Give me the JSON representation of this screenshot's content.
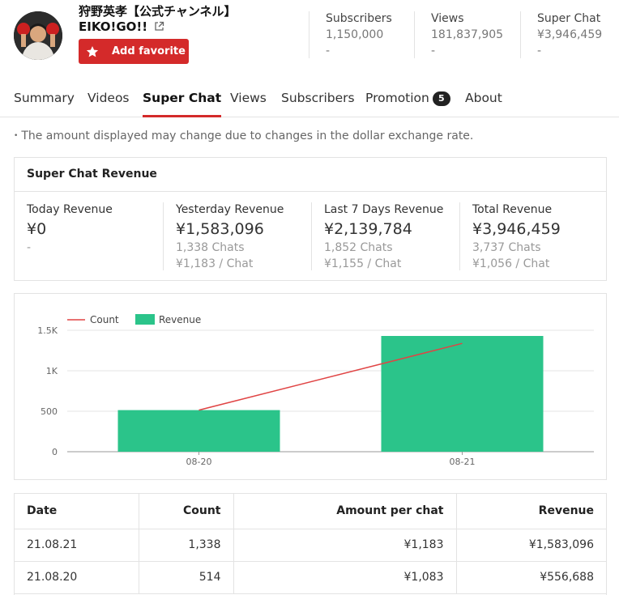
{
  "channel": {
    "name_line1": "狩野英孝【公式チャンネル】",
    "name_line2": "EIKO!GO!!",
    "favorite_label": "Add favorite"
  },
  "stats": [
    {
      "label": "Subscribers",
      "value": "1,150,000",
      "delta": "-"
    },
    {
      "label": "Views",
      "value": "181,837,905",
      "delta": "-"
    },
    {
      "label": "Super Chat",
      "value": "¥3,946,459",
      "delta": "-"
    }
  ],
  "tabs": [
    {
      "label": "Summary"
    },
    {
      "label": "Videos"
    },
    {
      "label": "Super Chat",
      "active": true
    },
    {
      "label": "Views"
    },
    {
      "label": "Subscribers"
    },
    {
      "label": "Promotion",
      "badge": "5"
    },
    {
      "label": "About"
    }
  ],
  "note": "The amount displayed may change due to changes in the dollar exchange rate.",
  "revenue": {
    "title": "Super Chat Revenue",
    "cells": [
      {
        "label": "Today Revenue",
        "amount": "¥0",
        "chats": "-",
        "per_chat": ""
      },
      {
        "label": "Yesterday Revenue",
        "amount": "¥1,583,096",
        "chats": "1,338 Chats",
        "per_chat": "¥1,183 / Chat"
      },
      {
        "label": "Last 7 Days Revenue",
        "amount": "¥2,139,784",
        "chats": "1,852 Chats",
        "per_chat": "¥1,155 / Chat"
      },
      {
        "label": "Total Revenue",
        "amount": "¥3,946,459",
        "chats": "3,737 Chats",
        "per_chat": "¥1,056 / Chat"
      }
    ]
  },
  "chart_data": {
    "type": "bar",
    "categories": [
      "08-20",
      "08-21"
    ],
    "series": [
      {
        "name": "Revenue",
        "kind": "bar",
        "color": "#2bc48a",
        "values": [
          514,
          1430
        ]
      },
      {
        "name": "Count",
        "kind": "line",
        "color": "#e04444",
        "values": [
          514,
          1338
        ]
      }
    ],
    "yticks": [
      "0",
      "500",
      "1K",
      "1.5K"
    ],
    "ylim": [
      0,
      1500
    ],
    "legend": "top-left",
    "grid": true
  },
  "table": {
    "headers": [
      "Date",
      "Count",
      "Amount per chat",
      "Revenue"
    ],
    "rows": [
      [
        "21.08.21",
        "1,338",
        "¥1,183",
        "¥1,583,096"
      ],
      [
        "21.08.20",
        "514",
        "¥1,083",
        "¥556,688"
      ]
    ]
  },
  "colors": {
    "brand_red": "#d42a2a",
    "bar_green": "#2bc48a",
    "line_red": "#e04444"
  }
}
